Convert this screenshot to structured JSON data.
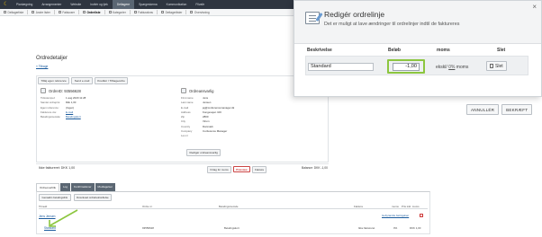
{
  "topnav": {
    "items": [
      "Planlægning",
      "Arrangementer",
      "Website",
      "Invitér og tjek",
      "Deltagere",
      "Spørgeskema",
      "Kommunikation",
      "Filvaltr"
    ],
    "active_index": 4
  },
  "subnav": {
    "items": [
      "Deltagerliste",
      "Andre lister",
      "Fakturaer",
      "Ordreliste",
      "Kategorier",
      "Fakturakrav",
      "Deltagerlister",
      "Overvisning"
    ],
    "active_index": 3
  },
  "page": {
    "title": "Ordredetaljer",
    "back_link": "« Tilbage"
  },
  "order_toolbar": {
    "add_reference": "Tilføj egen reference",
    "send_email": "Send e-mail",
    "credit": "Kreditér / Tilbageordre"
  },
  "order_info": {
    "heading": "OrdreID: 93556628",
    "rows": [
      {
        "k": "Tidsstempel:",
        "v": "1 aug 2020 11:28"
      },
      {
        "k": "Samlet ordrepris:",
        "v": "Dkk 1,00"
      },
      {
        "k": "Egen reference:",
        "v": "(Ingen)"
      },
      {
        "k": "Fakturere via:",
        "v": "E-mail"
      },
      {
        "k": "Betalingsmetode:",
        "v": "Betalingskort"
      }
    ]
  },
  "buyer_info": {
    "heading": "Ordreansvarlig",
    "rows": [
      {
        "k": "First name",
        "v": "Jens"
      },
      {
        "k": "Last name",
        "v": "Jensen"
      },
      {
        "k": "E-mail",
        "v": "jej@conferencemanager.dk"
      },
      {
        "k": "Address",
        "v": "Kongevejen 100"
      },
      {
        "k": "Zip",
        "v": "2800"
      },
      {
        "k": "City",
        "v": "Virum"
      },
      {
        "k": "Country",
        "v": "Danmark"
      },
      {
        "k": "Company",
        "v": "Conference Manager"
      },
      {
        "k": "Lev.nr",
        "v": ""
      }
    ],
    "edit_button": "Redigér ordreansvarlig"
  },
  "status": {
    "invoiced": "Ikke faktureret: DKK 1,00",
    "btn_moms": "Fritag for moms",
    "badge": "Præview",
    "btn_invoice": "Faktura",
    "balance": "Balance: DKK -1,00"
  },
  "tabs": {
    "items": [
      "Ordreoverblik",
      "Log",
      "Konfirmationer",
      "Modtagelser"
    ],
    "active_index": 0
  },
  "tab_toolbar": {
    "btn1": "Genaabn betalingslink",
    "btn2": "Download ordrebekræftelse"
  },
  "order_table": {
    "headers": [
      "Tilmeld",
      "Ordre nr.",
      "Betalingsmetode",
      "Faktura",
      "moms",
      "Pris inkl. moms"
    ],
    "customer_name": "Jens Jensen",
    "invoice_terms_link": "Gebyrandre betingelser",
    "row": {
      "name": "Standard",
      "order_no": "93556628",
      "payment": "Betalingskort",
      "invoice": "Ikke faktureret",
      "moms": "0%",
      "price": "DKK 1,00"
    }
  },
  "modal": {
    "title": "Redigér ordrelinje",
    "subtitle": "Det er muligt at lave ændringer til ordrelinjer indtil de faktureres",
    "headers": {
      "description": "Beskrivelse",
      "amount": "Beløb",
      "moms": "moms",
      "delete": "Slet"
    },
    "row": {
      "description": "Standard",
      "amount": "-1,00",
      "moms_prefix": "ekskl/",
      "moms_pct": "0%",
      "moms_suffix": "moms",
      "delete_label": "Slet"
    },
    "close_glyph": "×",
    "cancel": "ANNULLÉR",
    "confirm": "BEKRÆFT"
  },
  "colors": {
    "topbar": "#2e3540",
    "highlight": "#8cc63f",
    "link": "#1a5a9c"
  }
}
